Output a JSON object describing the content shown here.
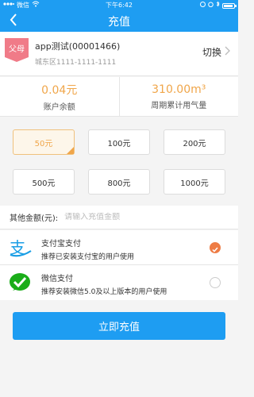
{
  "status_bar": {
    "carrier": "微信",
    "time": "下午6:42"
  },
  "nav": {
    "title": "充值",
    "back_icon": "chevron-left-icon"
  },
  "account": {
    "tag": "父母",
    "name": "app测试(00001466)",
    "address": "城东区1111-1111-1111",
    "switch_label": "切换"
  },
  "stats": [
    {
      "value": "0.04元",
      "label": "账户余额"
    },
    {
      "value": "310.00m³",
      "label": "周期累计用气量"
    }
  ],
  "amounts": [
    {
      "label": "50元",
      "selected": true
    },
    {
      "label": "100元",
      "selected": false
    },
    {
      "label": "200元",
      "selected": false
    },
    {
      "label": "500元",
      "selected": false
    },
    {
      "label": "800元",
      "selected": false
    },
    {
      "label": "1000元",
      "selected": false
    }
  ],
  "other_amount": {
    "label": "其他金额(元):",
    "placeholder": "请输入充值金额"
  },
  "payment_methods": [
    {
      "name": "支付宝支付",
      "desc": "推荐已安装支付宝的用户使用",
      "icon": "alipay-icon",
      "selected": true
    },
    {
      "name": "微信支付",
      "desc": "推荐安装微信5.0及以上版本的用户使用",
      "icon": "wechat-pay-icon",
      "selected": false
    }
  ],
  "submit_label": "立即充值",
  "colors": {
    "primary": "#1e9df2",
    "accent": "#f0a64a",
    "selected_radio": "#ee7c45",
    "tag": "#f07b88",
    "alipay": "#1a9ee5",
    "wechat": "#1aad19"
  }
}
